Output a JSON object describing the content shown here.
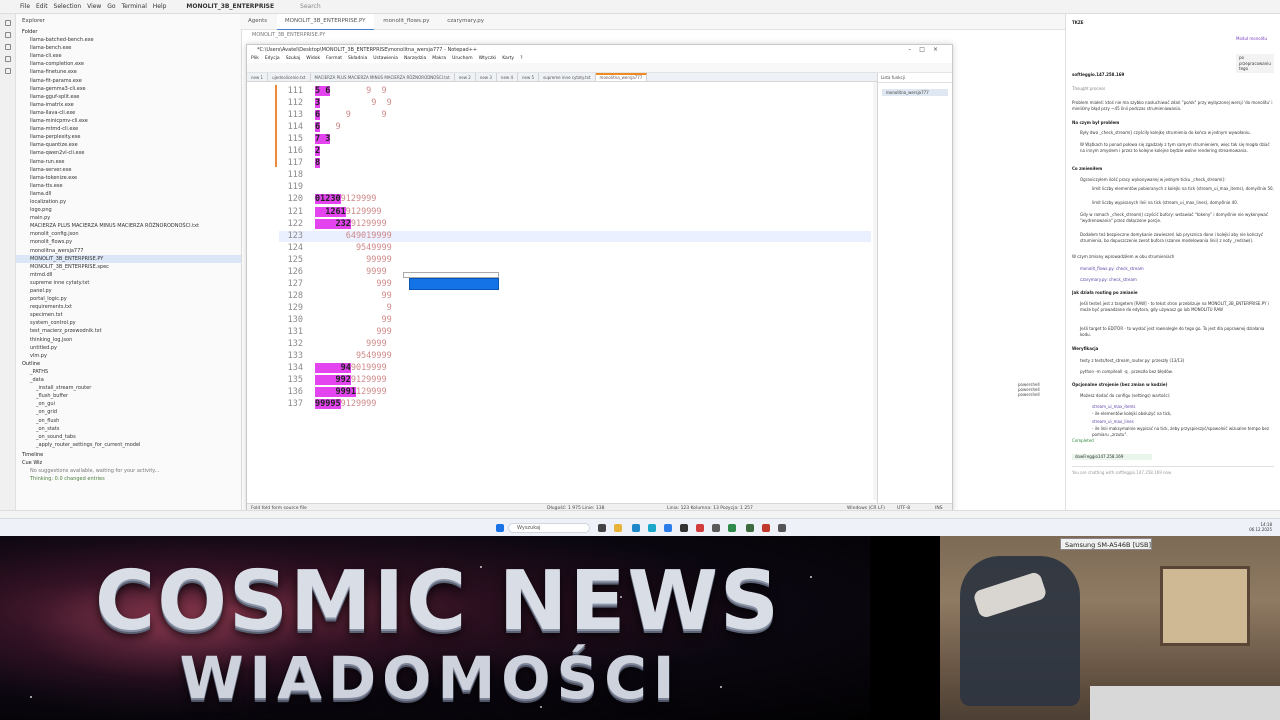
{
  "ide": {
    "menu": [
      "File",
      "Edit",
      "Selection",
      "View",
      "Go",
      "Terminal",
      "Help"
    ],
    "project": "MONOLIT_3B_ENTERPRISE",
    "search_placeholder": "Search",
    "tabs": [
      "Agents",
      "MONOLIT_3B_ENTERPRISE.PY",
      "monolit_flows.py",
      "czarymary.py"
    ],
    "breadcrumb": "MONOLIT_3B_ENTERPRISE.PY",
    "explorer_title": "Explorer",
    "folder_label": "Folder",
    "files": [
      "llama-batched-bench.exe",
      "llama-bench.exe",
      "llama-cli.exe",
      "llama-completion.exe",
      "llama-finetune.exe",
      "llama-fit-params.exe",
      "llama-gemma3-cli.exe",
      "llama-gguf-split.exe",
      "llama-imatrix.exe",
      "llama-llava-cli.exe",
      "llama-minicpmv-cli.exe",
      "llama-mtmd-cli.exe",
      "llama-perplexity.exe",
      "llama-quantize.exe",
      "llama-qwen2vl-cli.exe",
      "llama-run.exe",
      "llama-server.exe",
      "llama-tokenize.exe",
      "llama-tts.exe",
      "llama.dll",
      "localization.py",
      "logo.png",
      "main.py",
      "MACIERZA PLUS MACIERZA MINUS MACIERZA RÓŻNORODNOŚCI.txt",
      "monolit_config.json",
      "monolit_flows.py",
      "monolitna_wersja777",
      "MONOLIT_3B_ENTERPRISE.PY",
      "MONOLIT_3B_ENTERPRISE.spec",
      "mtmd.dll",
      "supreme inne cytaty.txt",
      "panel.py",
      "portal_logic.py",
      "requirements.txt",
      "specimen.txt",
      "system_control.py",
      "test_macierz_przewodnik.txt",
      "thinking_log.json",
      "untitled.py",
      "vlm.py"
    ],
    "outline_title": "Outline",
    "outline_items": [
      "_PATHS",
      "_data",
      "_install_stream_router",
      "_flush_buffer",
      "_on_gui",
      "_on_grid",
      "_on_flush",
      "_on_stats",
      "_on_sound_tabs",
      "_apply_router_settings_for_current_model"
    ],
    "timeline_title": "Timeline",
    "console_title": "Cue Wiz",
    "console_lines": [
      "No suggestions available, waiting for your activity...",
      "Thinking: 0.0 changed entries"
    ]
  },
  "npp": {
    "title": "*C:\\Users\\Avatel\\Desktop\\MONOLIT_3B_ENTERPRISE\\monolitna_wersja777 - Notepad++",
    "menu": [
      "Plik",
      "Edycja",
      "Szukaj",
      "Widok",
      "Format",
      "Składnia",
      "Ustawienia",
      "Narzędzia",
      "Makra",
      "Uruchom",
      "Wtyczki",
      "Karty",
      "?"
    ],
    "tabs": [
      "new 1",
      "ujednolicenie.txt",
      "MACIERZA PLUS MACIERZA MINUS MACIERZA RÓŻNORODNOŚCI.txt",
      "new 2",
      "new 3",
      "new 4",
      "new 5",
      "supreme inne cytaty.txt",
      "monolitna_wersja777"
    ],
    "lines": [
      {
        "n": "111",
        "a": "5 6",
        "b": "       9  9"
      },
      {
        "n": "112",
        "a": "3",
        "b": "          9  9"
      },
      {
        "n": "113",
        "a": "6",
        "b": "     9      9"
      },
      {
        "n": "114",
        "a": "6",
        "b": "   9"
      },
      {
        "n": "115",
        "a": "7 3",
        "b": ""
      },
      {
        "n": "116",
        "a": "2",
        "b": ""
      },
      {
        "n": "117",
        "a": "8",
        "b": ""
      },
      {
        "n": "118",
        "a": "",
        "b": ""
      },
      {
        "n": "119",
        "a": "",
        "b": ""
      },
      {
        "n": "120",
        "a": "01230",
        "b": "9129999"
      },
      {
        "n": "121",
        "a": "  1261",
        "b": "9129999"
      },
      {
        "n": "122",
        "a": "    232",
        "b": "9129999"
      },
      {
        "n": "123",
        "a": "",
        "b": "      649019999"
      },
      {
        "n": "124",
        "a": "",
        "b": "        9549999"
      },
      {
        "n": "125",
        "a": "",
        "b": "          99999"
      },
      {
        "n": "126",
        "a": "",
        "b": "          9999"
      },
      {
        "n": "127",
        "a": "",
        "b": "            999"
      },
      {
        "n": "128",
        "a": "",
        "b": "             99"
      },
      {
        "n": "129",
        "a": "",
        "b": "              9"
      },
      {
        "n": "130",
        "a": "",
        "b": "             99"
      },
      {
        "n": "131",
        "a": "",
        "b": "            999"
      },
      {
        "n": "132",
        "a": "",
        "b": "          9999"
      },
      {
        "n": "133",
        "a": "",
        "b": "        9549999"
      },
      {
        "n": "134",
        "a": "     94",
        "b": "9019999"
      },
      {
        "n": "135",
        "a": "    992",
        "b": "9129999"
      },
      {
        "n": "136",
        "a": "    9991",
        "b": "129999"
      },
      {
        "n": "137",
        "a": "99995",
        "b": "9129999"
      }
    ],
    "status": {
      "left": "Fold fold form source file",
      "pos": "Długość: 1 975   Linie: 138",
      "cursor": "Linia: 123   Kolumna: 13   Pozycja: 1 257",
      "eol": "Windows (CR LF)",
      "enc": "UTF-8",
      "mode": "INS"
    },
    "function_list_title": "Lista funkcji",
    "function_list_item": "monolitna_wersja777"
  },
  "chat": {
    "title": "TKZE",
    "badge": "Moduł monolitu",
    "user_prompt": "po przepracowaniu tego",
    "model": "softleggio.147.258.169",
    "thought": "Thought process",
    "p1": "Problem miałeś: ktoś nie ma szybko nasłuchiwać zdań \"po/ok\" przy wyłączonej wersji 'do monolitu' i mieliśmy błąd przy ~45 linii podczas strumieniowania.",
    "h1": "Na czym był problem",
    "b1": "Były dwa _check_stream() czyściły kolejkę strumienia do końca w jednym wywołaniu.",
    "b2": "W Wątkach to ponad połowa się zgadzały z tym samym strumieniem, więc tak się mogło dziać na innym zmysłem i przez to kolejne kolejne będzie wolne rendering streamowania.",
    "h2": "Co zmieniłem",
    "b3": "Ograniczyłem ilość pracy wykonywanej w jednym ticku _check_stream():",
    "b3a": "limit liczby elementów pobieranych z kolejki na tick (stream_ui_max_items), domyślnie 50,",
    "b3b": "limit liczby wypisanych linii na tick (stream_ui_max_lines), domyślnie 40.",
    "b4": "Gdy w ramach _check_stream() czyścić bufory: wstawiać \"tokeny\" i domyślnie nie wykonywać \"wydrenowania\" przez dołączone porcje.",
    "b5": "Dodałem też bezpieczne domykanie zawieszeń lub prysznica done i kolejki aby nie kończyć strumienia, bo dopuszczenie zwrot bufora (szanse modelowania linii) z noty _redraw().",
    "h3": "W czym zmiany wprowadziłem w obu strumieniach",
    "code1": "monolit_flows.py: check_stream",
    "code2": "czarymary.py: check_stream",
    "h4": "Jak działa routing po zmianie",
    "b6": "Jeśli testeś jest z targetem [RAW] - to tekst stron przeblizuje na MONOLIT_3B_ENTERPRISE.PY i może być prowadzone do edytora, gdy używasz go lub MONOLITU RAW",
    "b7": "Jeśli target to EDITOR - to wysłać jest rownolegle do tego go. To jest dla poprawnej działania kodu.",
    "h5": "Weryfikacja",
    "b8": "testy z tests/test_stream_router.py: przeszły (13/13)",
    "b9": "python -m compileall -q . przeszło bez błędów.",
    "h6": "Opcjonalne strojenie (bez zmian w kodzie)",
    "b10": "Możesz dodać do configu (settings) wartości:",
    "c3": "stream_ui_max_items",
    "c3d": "- ile elementów kolejki obsłużyć na tick,",
    "c4": "stream_ui_max_lines",
    "c4d": "- ile linii maksymalnie wypisać na tick, żeby przyspieszyć/spowolnić wizualne tempo bez pomiaru „zrzutu\".",
    "completed": "Completed",
    "chip": "dowFreggio147.258.169",
    "input_placeholder": "You are chatting with softleggio.147.258.169 now",
    "terminals": [
      "powershell",
      "powershell",
      "powershell"
    ]
  },
  "taskbar": {
    "search": "Wyszukaj",
    "time": "14:18",
    "date": "06.12.2025"
  },
  "banner": {
    "title": "COSMIC NEWS",
    "subtitle": "WIADOMOŚCI"
  },
  "webcam": {
    "label": "Samsung SM-A546B [USB]"
  }
}
